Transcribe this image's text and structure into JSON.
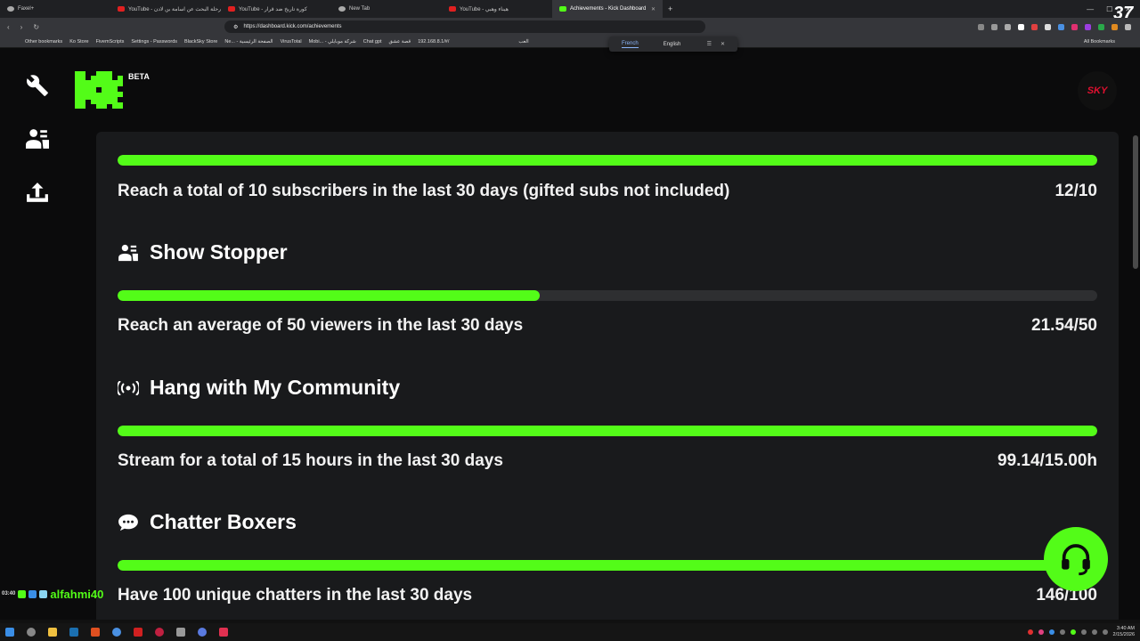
{
  "browser": {
    "tabs": [
      {
        "label": "Faxel+",
        "active": false,
        "icon": "misc"
      },
      {
        "label": "YouTube - رحلة البحث عن اسامة بن لادن",
        "active": false,
        "icon": "youtube"
      },
      {
        "label": "YouTube - كورة تاريخ ضد قرار",
        "active": false,
        "icon": "youtube"
      },
      {
        "label": "New Tab",
        "active": false,
        "icon": "misc"
      },
      {
        "label": "YouTube - هيناء وهبي",
        "active": false,
        "icon": "youtube"
      },
      {
        "label": "Achievements - Kick Dashboard",
        "active": true,
        "icon": "kick"
      }
    ],
    "new_tab": "+",
    "url": "https://dashboard.kick.com/achievements",
    "bookmarks": [
      "Other bookmarks",
      "Ko Store",
      "FivemScripts",
      "Settings - Passwords",
      "BlackSky Store",
      "Ne... - الصفحة الرئيسية",
      "VirusTotal",
      "Mobi... - شركة موبايلي",
      "Chat gpt",
      "قصة عشق",
      "192.168.8.1/#/",
      "العب"
    ],
    "all_bookmarks": "All Bookmarks",
    "translate": {
      "source": "French",
      "target": "English"
    },
    "corner_badge": "37"
  },
  "app": {
    "beta_label": "BETA",
    "avatar_text": "SKY",
    "accent": "#53fc18",
    "achievements": [
      {
        "title": "",
        "icon": "",
        "description": "Reach a total of 10 subscribers in the last 30 days (gifted subs not included)",
        "value": "12/10",
        "progress": 1.0
      },
      {
        "title": "Show Stopper",
        "icon": "viewers-icon",
        "description": "Reach an average of 50 viewers in the last 30 days",
        "value": "21.54/50",
        "progress": 0.4308
      },
      {
        "title": "Hang with My Community",
        "icon": "broadcast-icon",
        "description": "Stream for a total of 15 hours in the last 30 days",
        "value": "99.14/15.00h",
        "progress": 1.0
      },
      {
        "title": "Chatter Boxers",
        "icon": "chat-bubble-icon",
        "description": "Have 100 unique chatters in the last 30 days",
        "value": "146/100",
        "progress": 1.0
      }
    ]
  },
  "overlay": {
    "chat_time": "03:40",
    "chat_user": "alfahmi40"
  },
  "taskbar": {
    "time": "3:40 AM",
    "date": "2/15/2026"
  }
}
